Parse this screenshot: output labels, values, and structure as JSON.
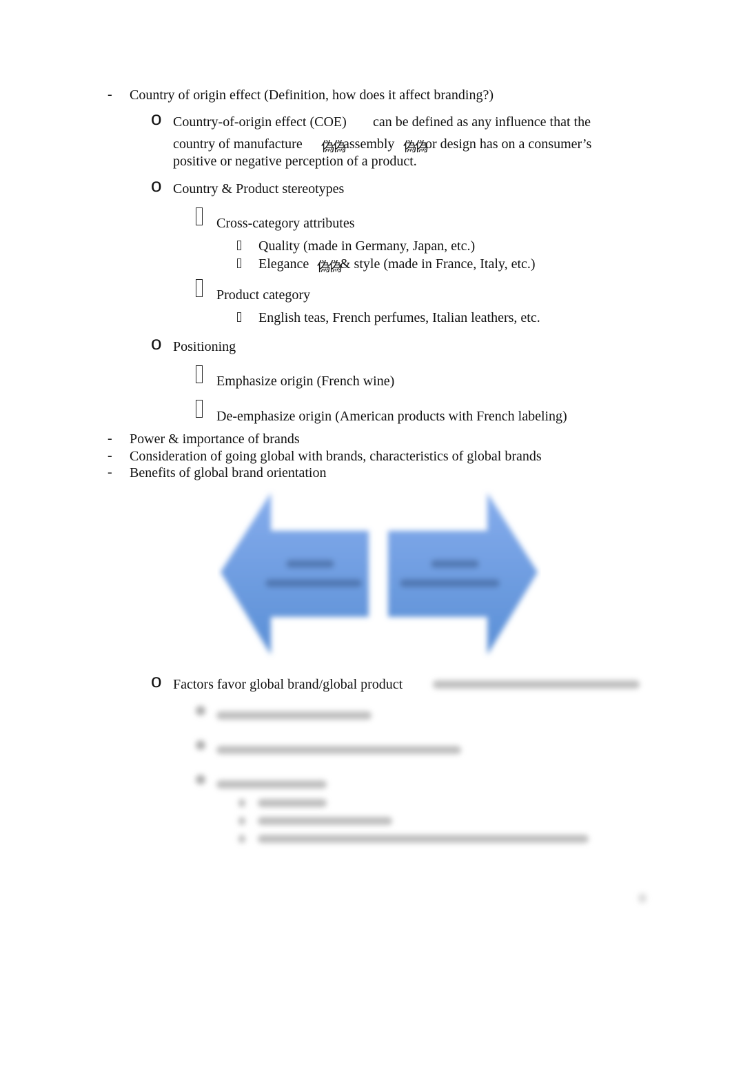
{
  "outline": {
    "item1": {
      "bullet": "-",
      "text": "Country of origin effect (Definition, how does it affect branding?)",
      "sub": [
        {
          "bullet": "o",
          "line1_a": "Country-of-origin effect (COE)",
          "line1_b": "can be defined as any influence that the",
          "line2_a": "country of manufacture",
          "line2_glyph1": "偽偽",
          "line2_b": "assembly",
          "line2_glyph2": "偽偽",
          "line2_c": "or design has on a consumer’s",
          "line3": "positive or negative perception of a product."
        },
        {
          "bullet": "o",
          "text": "Country & Product stereotypes",
          "sub": [
            {
              "text": "Cross-category attributes",
              "sub": [
                {
                  "text": "Quality (made in Germany, Japan, etc.)"
                },
                {
                  "text_a": "Elegance",
                  "glyph": "偽偽",
                  "text_b": "& style (made in France, Italy, etc.)"
                }
              ]
            },
            {
              "text": "Product category",
              "sub": [
                {
                  "text": "English teas, French perfumes, Italian leathers, etc."
                }
              ]
            }
          ]
        },
        {
          "bullet": "o",
          "text": "Positioning",
          "sub": [
            {
              "text": "Emphasize origin (French wine)"
            },
            {
              "text": "De-emphasize origin (American products with French labeling)"
            }
          ]
        }
      ]
    },
    "item2": {
      "bullet": "-",
      "text": "Power & importance of brands"
    },
    "item3": {
      "bullet": "-",
      "text": "Consideration of going global with brands, characteristics of global brands"
    },
    "item4": {
      "bullet": "-",
      "text": "Benefits of global brand orientation"
    },
    "factors": {
      "bullet": "o",
      "text": "Factors favor global brand/global product"
    }
  },
  "diagram": {
    "left_arrow_color": "#6f9fe2",
    "right_arrow_color": "#6f9fe2",
    "label_color": "#4a6fa8"
  }
}
